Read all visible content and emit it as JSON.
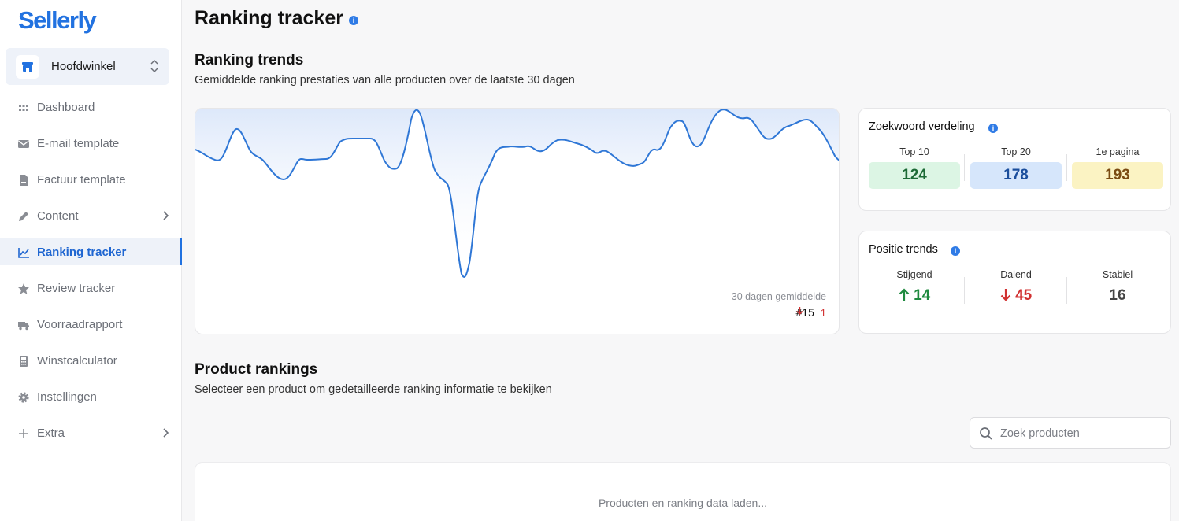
{
  "brand": {
    "logo": "Sellerly",
    "accent": "#2272e0"
  },
  "store": {
    "name": "Hoofdwinkel"
  },
  "sidebar": {
    "items": [
      {
        "label": "Dashboard",
        "icon": "grid-icon"
      },
      {
        "label": "E-mail template",
        "icon": "envelope-icon"
      },
      {
        "label": "Factuur template",
        "icon": "invoice-icon"
      },
      {
        "label": "Content",
        "icon": "pencil-icon",
        "has_submenu": true
      },
      {
        "label": "Ranking tracker",
        "icon": "chart-line-icon",
        "active": true
      },
      {
        "label": "Review tracker",
        "icon": "star-icon"
      },
      {
        "label": "Voorraadrapport",
        "icon": "truck-icon"
      },
      {
        "label": "Winstcalculator",
        "icon": "calculator-icon"
      },
      {
        "label": "Instellingen",
        "icon": "gear-icon"
      },
      {
        "label": "Extra",
        "icon": "plus-icon",
        "has_submenu": true
      }
    ]
  },
  "page": {
    "title": "Ranking tracker"
  },
  "trends": {
    "title": "Ranking trends",
    "subtitle": "Gemiddelde ranking prestaties van alle producten over de laatste 30 dagen",
    "avg_label": "30 dagen gemiddelde",
    "avg_value": "#15",
    "avg_delta": "1"
  },
  "distribution": {
    "title": "Zoekwoord verdeling",
    "cols": [
      {
        "label": "Top 10",
        "value": "124",
        "color": "green"
      },
      {
        "label": "Top 20",
        "value": "178",
        "color": "blue"
      },
      {
        "label": "1e pagina",
        "value": "193",
        "color": "yellow"
      }
    ]
  },
  "position_trends": {
    "title": "Positie trends",
    "cols": [
      {
        "label": "Stijgend",
        "value": "14",
        "direction": "up"
      },
      {
        "label": "Dalend",
        "value": "45",
        "direction": "down"
      },
      {
        "label": "Stabiel",
        "value": "16",
        "direction": "flat"
      }
    ]
  },
  "products": {
    "title": "Product rankings",
    "subtitle": "Selecteer een product om gedetailleerde ranking informatie te bekijken",
    "search_placeholder": "Zoek producten",
    "loading_text": "Producten en ranking data laden..."
  }
}
